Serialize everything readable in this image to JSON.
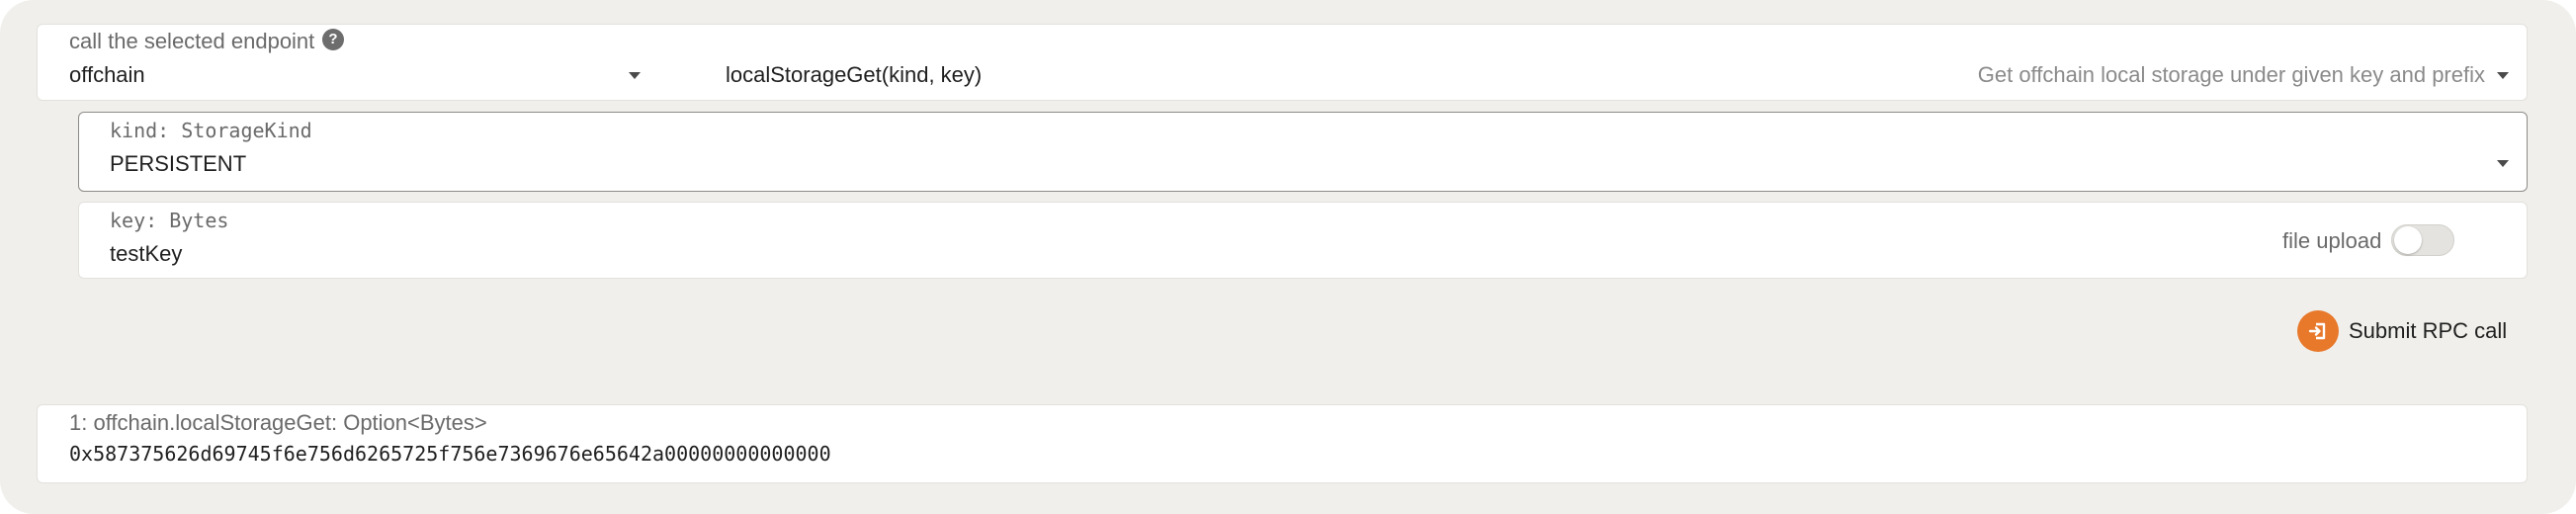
{
  "endpoint": {
    "label": "call the selected endpoint",
    "help_icon": "question-circle-icon",
    "section_value": "offchain",
    "method_value": "localStorageGet(kind, key)",
    "method_description": "Get offchain local storage under given key and prefix"
  },
  "params": {
    "kind": {
      "label": "kind: StorageKind",
      "value": "PERSISTENT"
    },
    "key": {
      "label": "key: Bytes",
      "value": "testKey",
      "file_upload_label": "file upload",
      "file_upload_enabled": false
    }
  },
  "submit": {
    "label": "Submit RPC call",
    "icon": "sign-in-arrow-icon",
    "accent_color": "#e8782a"
  },
  "result": {
    "label": "1: offchain.localStorageGet: Option<Bytes>",
    "value": "0x587375626d69745f6e756d6265725f756e7369676e65642a00000000000000"
  }
}
